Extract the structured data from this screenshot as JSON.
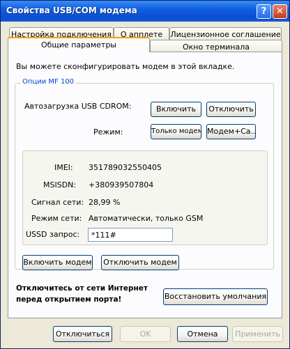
{
  "window": {
    "title": "Свойства USB/COM модема",
    "help_glyph": "?",
    "close_glyph": "✕"
  },
  "tabs": {
    "row1": [
      "Настройка подключения",
      "О апплете",
      "Лицензионное соглашение"
    ],
    "row2": [
      "Общие параметры",
      "Окно терминала"
    ],
    "active": "Общие параметры"
  },
  "panel": {
    "intro": "Вы можете сконфигурировать модем в этой вкладке.",
    "group_title": "Опции MF 100",
    "usb_cdrom": {
      "label": "Автозагрузка USB CDROM:",
      "enable": "Включить",
      "disable": "Отключить"
    },
    "mode": {
      "label": "Режим:",
      "modem_only": "Только модем",
      "modem_cd": "Модем+Ca.."
    },
    "info": {
      "imei_label": "IMEI:",
      "imei_value": "351789032550405",
      "msisdn_label": "MSISDN:",
      "msisdn_value": "+380939507804",
      "signal_label": "Сигнал сети:",
      "signal_value": "28,99 %",
      "netmode_label": "Режим сети:",
      "netmode_value": "Автоматически, только GSM",
      "ussd_label": "USSD запрос:",
      "ussd_value": "*111#"
    },
    "enable_modem": "Включить модем",
    "disable_modem": "Отключить модем",
    "warning_line1": "Отключитесь от сети Интернет",
    "warning_line2": "перед открытием порта!",
    "restore_defaults": "Восстановить умолчания"
  },
  "footer": {
    "disconnect": "Отключиться",
    "ok": "OK",
    "cancel": "Отмена",
    "apply": "Применить"
  }
}
